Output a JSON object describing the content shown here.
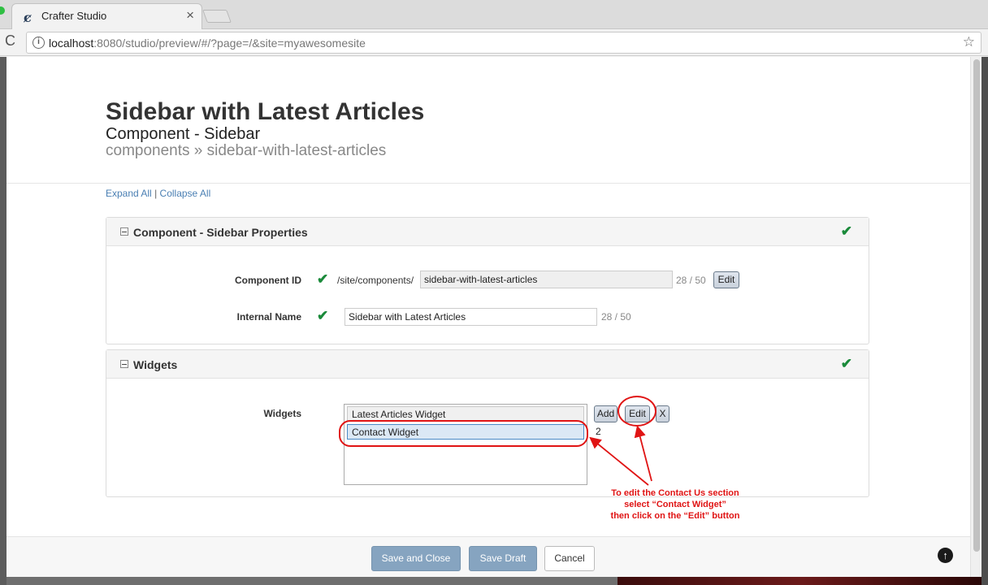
{
  "browser": {
    "tab_title": "Crafter Studio",
    "tab_icon": "crafter-logo-icon",
    "close_glyph": "×",
    "url_host": "localhost",
    "url_rest": ":8080/studio/preview/#/?page=/&site=myawesomesite",
    "reload_glyph": "C",
    "star_glyph": "☆",
    "info_glyph": "i"
  },
  "dialog": {
    "title": "Sidebar with Latest Articles",
    "content_type": "Component - Sidebar",
    "path": "components » sidebar-with-latest-articles",
    "expand_all": "Expand All",
    "separator": "|",
    "collapse_all": "Collapse All"
  },
  "sections": {
    "properties": {
      "title": "Component - Sidebar Properties",
      "component_id": {
        "label": "Component ID",
        "prefix": "/site/components/",
        "value": "sidebar-with-latest-articles",
        "counter": "28 / 50",
        "edit_label": "Edit"
      },
      "internal_name": {
        "label": "Internal Name",
        "value": "Sidebar with Latest Articles",
        "counter": "28 / 50"
      }
    },
    "widgets": {
      "title": "Widgets",
      "field_label": "Widgets",
      "items": [
        "Latest Articles Widget",
        "Contact Widget"
      ],
      "selected": "Contact Widget",
      "count": "2",
      "add_label": "Add",
      "edit_label": "Edit",
      "remove_label": "X"
    }
  },
  "annotation": {
    "line1": "To edit the Contact Us section",
    "line2": "select “Contact Widget”",
    "line3": "then click on the “Edit” button",
    "color": "#e01414"
  },
  "footer": {
    "save_close": "Save and Close",
    "save_draft": "Save Draft",
    "cancel": "Cancel",
    "scroll_top_glyph": "↑"
  },
  "check_glyph": "✔",
  "colors": {
    "link": "#4a7fb3",
    "valid_check": "#1a8a3a",
    "primary_button": "#86a4c0"
  }
}
